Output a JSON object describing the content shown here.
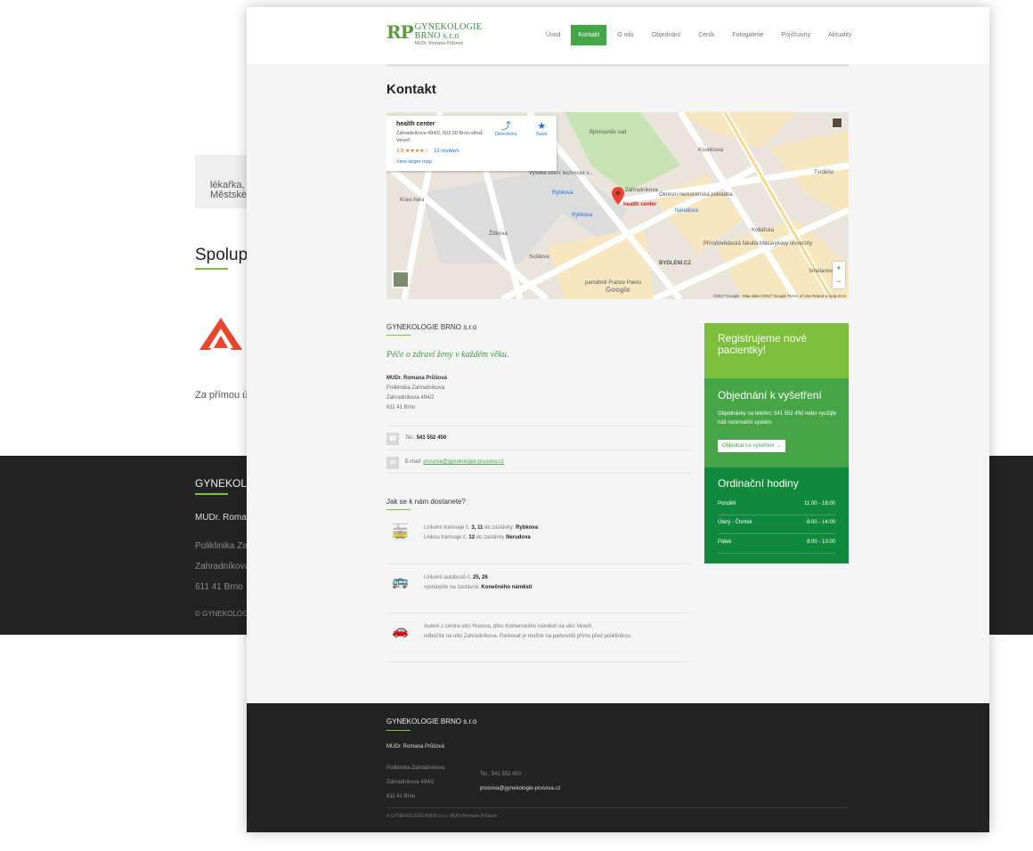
{
  "background": {
    "box_lines": [
      "lékařka, g",
      "Městské r"
    ],
    "heading": "Spolupr",
    "text": "Za přímou úhr",
    "footer": {
      "title": "GYNEKOLOG",
      "doctor": "MUDr. Roman",
      "lines": [
        "Poliklinika Zah",
        "Zahradníkova",
        "611 41 Brno"
      ],
      "copyright": "© GYNEKOLOGI"
    }
  },
  "header": {
    "logo_mark": "RP",
    "logo_line1": "GYNEKOLOGIE",
    "logo_line2": "BRNO s.r.o",
    "logo_line3": "MUDr. Romana Průšová",
    "nav": [
      "Úvod",
      "Kontakt",
      "O nás",
      "Objednání",
      "Ceník",
      "Fotogalerie",
      "Pojišťovny",
      "Aktuality"
    ],
    "active_nav": "Kontakt"
  },
  "page_title": "Kontakt",
  "map": {
    "place_name": "health center",
    "place_address": "Zahradníkova 494/2, 602 00 Brno-střed-Veveří",
    "rating": "3.8 ★★★★☆",
    "reviews": "13 reviews",
    "view_larger": "View larger map",
    "directions": "Directions",
    "save": "Save",
    "pin_label": "health center",
    "labels": [
      "Vysoké učení technické v...",
      "Björnsonův sad",
      "Okresní nemocenská pokladna",
      "Přírodovědecká fakulta Masarykovy univerzity",
      "BYDLENI.CZ",
      "Rybkova",
      "Rybkova",
      "Nerudova",
      "Zahradníkova",
      "Kounicova",
      "Kotlářská",
      "Žižkova",
      "Kravi hora",
      "památník Franze Pawlu",
      "Tvrdého",
      "Smetanova",
      "Sušilova"
    ],
    "zoom_in": "+",
    "zoom_out": "−",
    "footer_text": "©2017 Google · Map data ©2017 Google   Terms of Use   Report a map error",
    "google": "Google"
  },
  "company": {
    "name": "GYNEKOLOGIE BRNO s.r.o",
    "slogan": "Péče o zdraví ženy v každém věku.",
    "doctor": "MUDr. Romana Průšová",
    "address": [
      "Poliklinika Zahradníkova",
      "Zahradníkova 494/2",
      "611 41 Brno"
    ],
    "phone_label": "Tel.:",
    "phone": "541 552 450",
    "email_label": "E-mail:",
    "email": "prusova@gynekologie-prusova.cz"
  },
  "how": {
    "title": "Jak se k nám dostanete?",
    "tram": {
      "a": "Linkami tramvaje č.",
      "lines": "3, 11",
      "b": "do zastávky:",
      "stop": "Rybkova",
      "c": "Linkou tramvaje č.",
      "line2": "12",
      "d": "do zastávky",
      "stop2": "Nerudova"
    },
    "bus": {
      "a": "Linkami autobusů č.",
      "lines": "25, 26",
      "b": "vystoupíte na zastávce:",
      "stop": "Konečného náměstí"
    },
    "car": {
      "line1": "Autem z centra ulicí Husova, přes Komenského náměstí na ulici Veveří,",
      "line2": "odbočíte na ulici Zahradníkova. Parkovat je možné na parkovišti přímo před poliklinikou."
    }
  },
  "sidebar": {
    "register": "Registrujeme nové pacientky!",
    "order_title": "Objednání k vyšetření",
    "order_text": "Objednávky na telefon: 541 552 450 nebo využijte náš rezervační systém.",
    "order_button": "Objednat na vyšetření  →",
    "hours_title": "Ordinační hodiny",
    "hours": [
      {
        "day": "Pondělí",
        "time": "11.00 - 18.00"
      },
      {
        "day": "Úterý - Čtvrtek",
        "time": "8:00 - 14:00"
      },
      {
        "day": "Pátek",
        "time": "8:00 - 13:00"
      }
    ]
  },
  "footer": {
    "title": "GYNEKOLOGIE BRNO s.r.o",
    "doctor": "MUDr. Romana Průšová",
    "address": [
      "Poliklinika Zahradníkova",
      "Zahradníkova 494/2",
      "611 41 Brno"
    ],
    "phone": "Tel.: 541 552 450",
    "email": "prusova@gynekologie-prusova.cz",
    "copyright": "© GYNEKOLOGIE BRNO s.r.o, MUDr.Romana Průšová"
  },
  "colors": {
    "green": "#43a647",
    "light_green": "#7cbf3c",
    "dark_green": "#0f8a3c",
    "footer_bg": "#232323"
  }
}
